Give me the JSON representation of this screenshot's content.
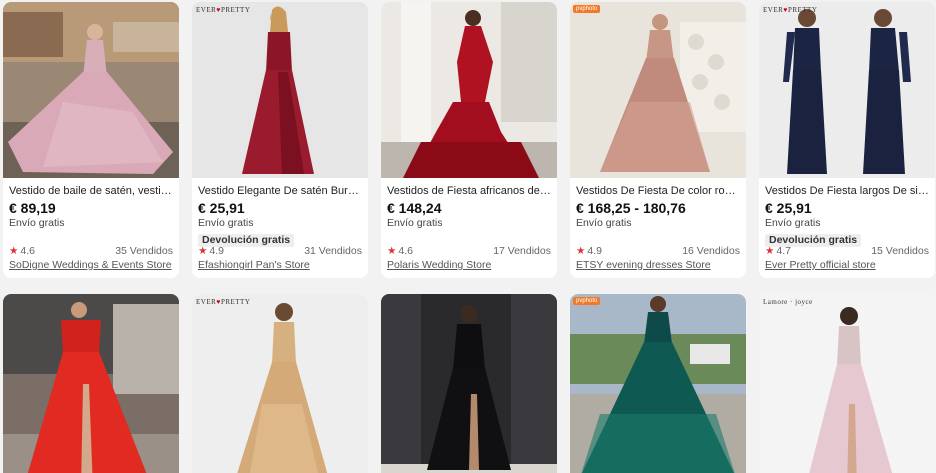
{
  "products": [
    {
      "title": "Vestido de baile de satén, vestido …",
      "price": "€ 89,19",
      "shipping": "Envío gratis",
      "badge": "",
      "rating": "4.6",
      "sold": "35 Vendidos",
      "store": "SoDigne Weddings & Events Store",
      "image_icon": "pink-ballgown-image"
    },
    {
      "title": "Vestido Elegante De satén Burdeo…",
      "price": "€ 25,91",
      "shipping": "Envío gratis",
      "badge": "Devolución gratis",
      "rating": "4.9",
      "sold": "31 Vendidos",
      "store": "Efashiongirl Pan's Store",
      "brand_prefix": "EVER",
      "brand_suffix": "PRETTY",
      "image_icon": "burgundy-gown-image"
    },
    {
      "title": "Vestidos de Fiesta africanos de sir…",
      "price": "€ 148,24",
      "shipping": "Envío gratis",
      "badge": "",
      "rating": "4.6",
      "sold": "17 Vendidos",
      "store": "Polaris Wedding Store",
      "image_icon": "red-mermaid-gown-image"
    },
    {
      "title": "Vestidos De Fiesta De color rosa br…",
      "price": "€ 168,25 - 180,76",
      "shipping": "Envío gratis",
      "badge": "",
      "rating": "4.9",
      "sold": "16 Vendidos",
      "store": "ETSY evening dresses Store",
      "etsy_tag": "pvphoto",
      "image_icon": "rose-gold-sequin-gown-image"
    },
    {
      "title": "Vestidos De Fiesta largos De siren…",
      "price": "€ 25,91",
      "shipping": "Envío gratis",
      "badge": "Devolución gratis",
      "rating": "4.7",
      "sold": "15 Vendidos",
      "store": "Ever Pretty official store",
      "brand_prefix": "EVER",
      "brand_suffix": "PRETTY",
      "image_icon": "navy-long-sleeve-gown-image"
    }
  ],
  "row2": [
    {
      "image_icon": "red-off-shoulder-gown-image"
    },
    {
      "image_icon": "gold-sequin-gown-image",
      "brand_prefix": "EVER",
      "brand_suffix": "PRETTY"
    },
    {
      "image_icon": "black-lace-gown-image"
    },
    {
      "image_icon": "green-sequin-ballgown-image",
      "etsy_tag": "pvphoto"
    },
    {
      "image_icon": "blush-tulle-gown-image",
      "brand_text": "Lamore · joyce"
    }
  ],
  "colors": {
    "star": "#e0323a",
    "page_bg": "#f2f2f2",
    "card_bg": "#ffffff"
  }
}
